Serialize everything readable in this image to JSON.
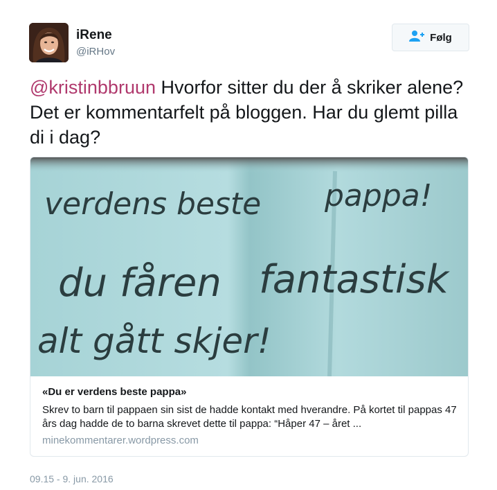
{
  "user": {
    "name": "iRene",
    "handle": "@iRHov"
  },
  "follow_button": {
    "label": "Følg",
    "icon": "add-user-icon"
  },
  "tweet": {
    "mention": "@kristinbbruun",
    "text": " Hvorfor sitter du der å skriker alene? Det er kommentarfelt på bloggen. Har du glemt pilla di i dag?",
    "timestamp": "09.15 - 9. jun. 2016"
  },
  "card": {
    "image_text": {
      "line1a": "verdens beste",
      "line1b": "pappa!",
      "line2a": "du fåren",
      "line2b": "fantastisk",
      "line3": "alt gått skjer!"
    },
    "title": "«Du er verdens beste pappa»",
    "description": "Skrev to barn til pappaen sin sist de hadde kontakt med hverandre. På kortet til pappas 47 års dag hadde de to barna skrevet dette til pappa:       “Håper 47 – året ...",
    "domain": "minekommentarer.wordpress.com"
  },
  "colors": {
    "mention": "#b0396d",
    "muted": "#657786",
    "card_image_bg": "#9fcdd0"
  }
}
